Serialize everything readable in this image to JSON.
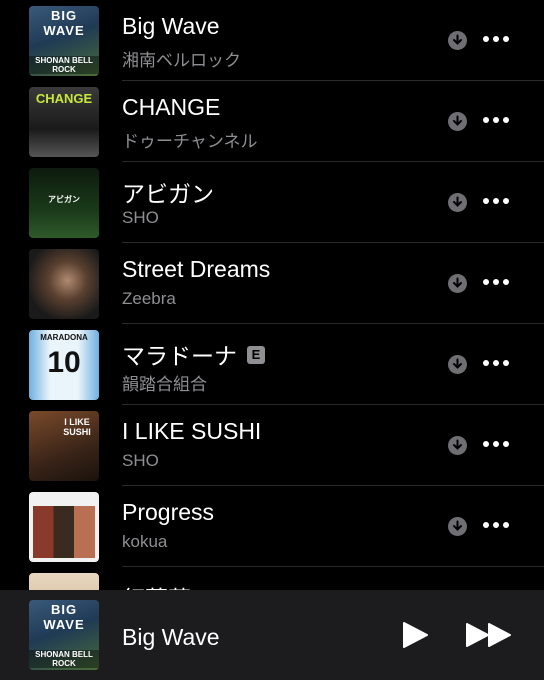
{
  "tracks": [
    {
      "title": "Big Wave",
      "artist": "湘南ベルロック",
      "art_label": "BIG WAVE",
      "art_sub": "SHONAN BELL ROCK",
      "explicit": false
    },
    {
      "title": "CHANGE",
      "artist": "ドゥーチャンネル",
      "art_label": "CHANGE",
      "explicit": false
    },
    {
      "title": "アビガン",
      "artist": "SHO",
      "art_label": "アビガン",
      "explicit": false
    },
    {
      "title": "Street Dreams",
      "artist": "Zeebra",
      "explicit": false
    },
    {
      "title": "マラドーナ",
      "artist": "韻踏合組合",
      "art_label": "MARADONA",
      "art_sub": "10",
      "explicit": true,
      "explicit_label": "E"
    },
    {
      "title": "I LIKE SUSHI",
      "artist": "SHO",
      "art_label": "I LIKE SUSHI",
      "explicit": false
    },
    {
      "title": "Progress",
      "artist": "kokua",
      "explicit": false
    },
    {
      "title": "紅蓮華",
      "artist": "",
      "explicit": false
    }
  ],
  "icons": {
    "download": "download-cloud-icon",
    "more": "more-ellipsis-icon",
    "play": "play-icon",
    "forward": "fast-forward-icon"
  },
  "now_playing": {
    "title": "Big Wave",
    "art_label": "BIG WAVE",
    "art_sub": "SHONAN BELL ROCK"
  },
  "colors": {
    "background": "#000000",
    "player_bg": "#1c1c1e",
    "secondary_text": "#8e8e93",
    "download_icon": "#6e6e73"
  }
}
